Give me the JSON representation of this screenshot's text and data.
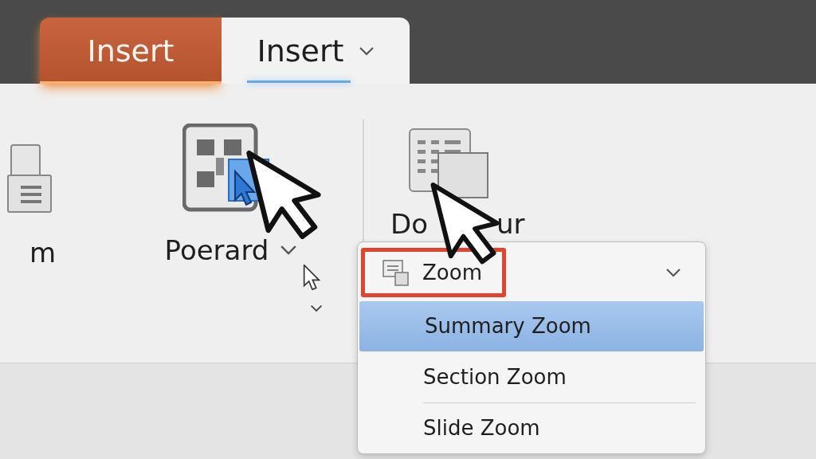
{
  "tabs": [
    {
      "label": "Insert",
      "selected": true,
      "has_dropdown": false
    },
    {
      "label": "Insert",
      "selected": false,
      "has_dropdown": true
    }
  ],
  "ribbon": {
    "groups": [
      {
        "kind": "partial",
        "label": "m"
      },
      {
        "kind": "split",
        "label": "Poerard"
      },
      {
        "kind": "large",
        "label_parts": [
          "Do",
          "ur"
        ]
      }
    ]
  },
  "dropdown": {
    "header": {
      "label": "Zoom",
      "highlighted": true
    },
    "items": [
      {
        "label": "Summary Zoom",
        "selected": true,
        "separator_before": false
      },
      {
        "label": "Section Zoom",
        "selected": false,
        "separator_before": false
      },
      {
        "label": "Slide Zoom",
        "selected": false,
        "separator_before": true
      }
    ]
  }
}
